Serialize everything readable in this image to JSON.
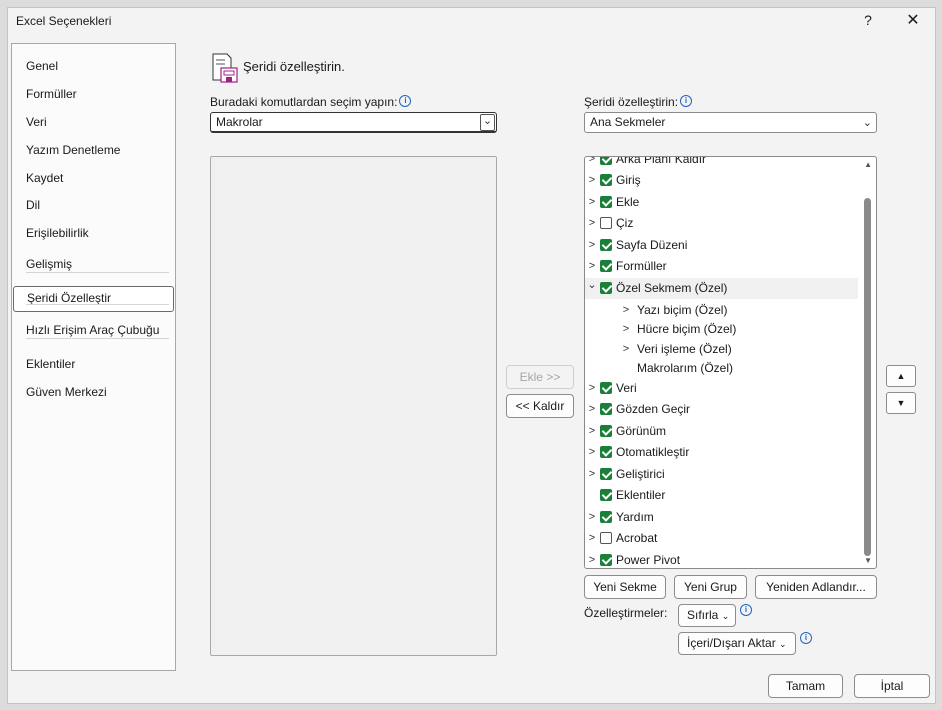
{
  "window": {
    "title": "Excel Seçenekleri",
    "help": "?",
    "close": "✕"
  },
  "nav": {
    "items": [
      {
        "label": "Genel"
      },
      {
        "label": "Formüller"
      },
      {
        "label": "Veri"
      },
      {
        "label": "Yazım Denetleme"
      },
      {
        "label": "Kaydet"
      },
      {
        "label": "Dil"
      },
      {
        "label": "Erişilebilirlik"
      },
      {
        "label": "Gelişmiş"
      },
      {
        "label": "Şeridi Özelleştir",
        "selected": true
      },
      {
        "label": "Hızlı Erişim Araç Çubuğu"
      },
      {
        "label": "Eklentiler"
      },
      {
        "label": "Güven Merkezi"
      }
    ]
  },
  "main": {
    "header": "Şeridi özelleştirin.",
    "commands_label": "Buradaki komutlardan seçim yapın:",
    "commands_value": "Makrolar",
    "ribbon_label": "Şeridi özelleştirin:",
    "ribbon_value": "Ana Sekmeler",
    "add_button": "Ekle >>",
    "remove_button": "<< Kaldır",
    "tree": [
      {
        "label": "Arka Planı Kaldır",
        "checked": true,
        "chevron": ">",
        "level": 0,
        "cut": true
      },
      {
        "label": "Giriş",
        "checked": true,
        "chevron": ">",
        "level": 0
      },
      {
        "label": "Ekle",
        "checked": true,
        "chevron": ">",
        "level": 0
      },
      {
        "label": "Çiz",
        "checked": false,
        "chevron": ">",
        "level": 0
      },
      {
        "label": "Sayfa Düzeni",
        "checked": true,
        "chevron": ">",
        "level": 0
      },
      {
        "label": "Formüller",
        "checked": true,
        "chevron": ">",
        "level": 0
      },
      {
        "label": "Özel Sekmem (Özel)",
        "checked": true,
        "chevron": "⌄",
        "level": 0,
        "highlight": true
      },
      {
        "label": "Yazı biçim (Özel)",
        "chevron": ">",
        "level": 1
      },
      {
        "label": "Hücre biçim (Özel)",
        "chevron": ">",
        "level": 1
      },
      {
        "label": "Veri işleme (Özel)",
        "chevron": ">",
        "level": 1
      },
      {
        "label": "Makrolarım (Özel)",
        "chevron": "",
        "level": 1
      },
      {
        "label": "Veri",
        "checked": true,
        "chevron": ">",
        "level": 0
      },
      {
        "label": "Gözden Geçir",
        "checked": true,
        "chevron": ">",
        "level": 0
      },
      {
        "label": "Görünüm",
        "checked": true,
        "chevron": ">",
        "level": 0
      },
      {
        "label": "Otomatikleştir",
        "checked": true,
        "chevron": ">",
        "level": 0
      },
      {
        "label": "Geliştirici",
        "checked": true,
        "chevron": ">",
        "level": 0
      },
      {
        "label": "Eklentiler",
        "checked": true,
        "chevron": "",
        "level": 0
      },
      {
        "label": "Yardım",
        "checked": true,
        "chevron": ">",
        "level": 0
      },
      {
        "label": "Acrobat",
        "checked": false,
        "chevron": ">",
        "level": 0
      },
      {
        "label": "Power Pivot",
        "checked": true,
        "chevron": ">",
        "level": 0
      }
    ],
    "move_up": "▲",
    "move_down": "▼",
    "new_tab_button": "Yeni Sekme",
    "new_group_button": "Yeni Grup",
    "rename_button": "Yeniden Adlandır...",
    "customizations_label": "Özelleştirmeler:",
    "reset_button": "Sıfırla",
    "import_export_button": "İçeri/Dışarı Aktar"
  },
  "footer": {
    "ok": "Tamam",
    "cancel": "İptal"
  }
}
